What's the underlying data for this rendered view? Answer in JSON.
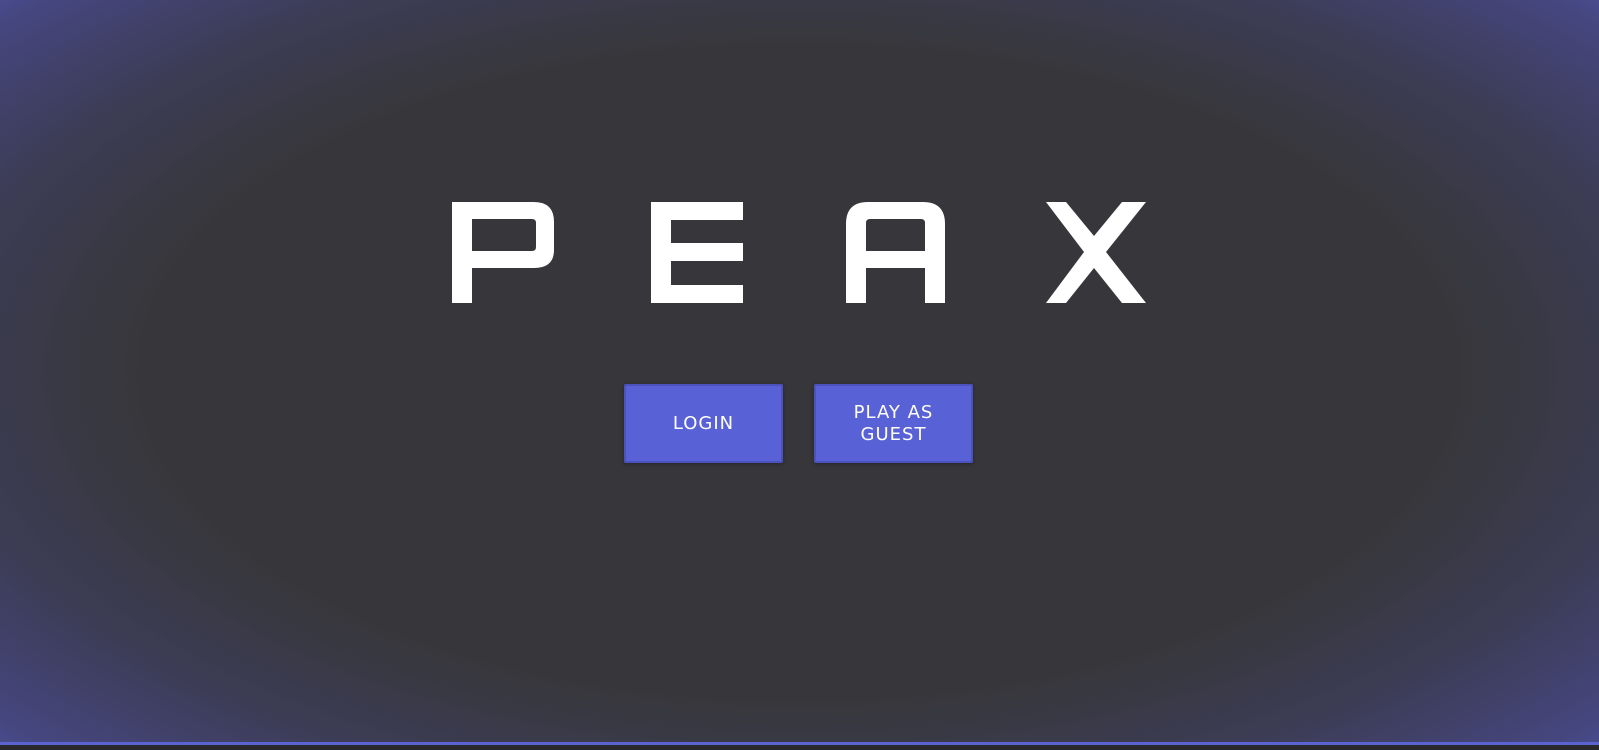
{
  "title": "PEAX",
  "buttons": {
    "login": "LOGIN",
    "guest": "PLAY AS GUEST"
  },
  "colors": {
    "background_center": "#37373b",
    "background_edge": "#5058b4",
    "accent": "#5862d6",
    "title_text": "#ffffff"
  }
}
